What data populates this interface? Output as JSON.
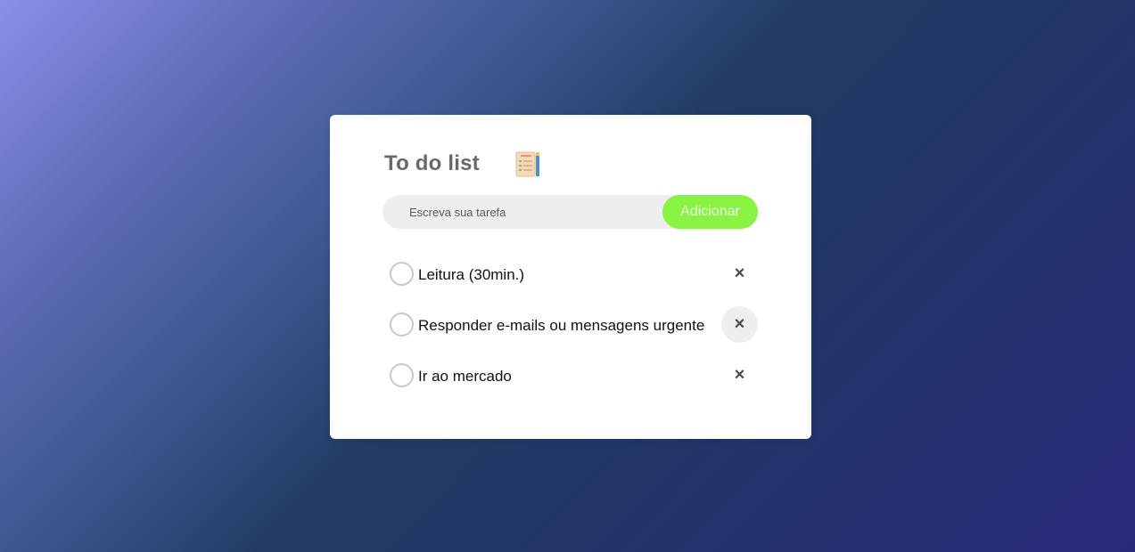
{
  "app": {
    "title": "To do list",
    "icon": "checklist-icon"
  },
  "input": {
    "placeholder": "Escreva sua tarefa",
    "value": ""
  },
  "add_button": {
    "label": "Adicionar"
  },
  "tasks": [
    {
      "label": "Leitura (30min.)",
      "checked": false,
      "delete_label": "×"
    },
    {
      "label": "Responder e-mails ou mensagens urgente",
      "checked": false,
      "delete_label": "×"
    },
    {
      "label": "Ir ao mercado",
      "checked": false,
      "delete_label": "×"
    }
  ],
  "colors": {
    "accent": "#8af243",
    "input_bg": "#edeef0",
    "title": "#6e6768"
  }
}
